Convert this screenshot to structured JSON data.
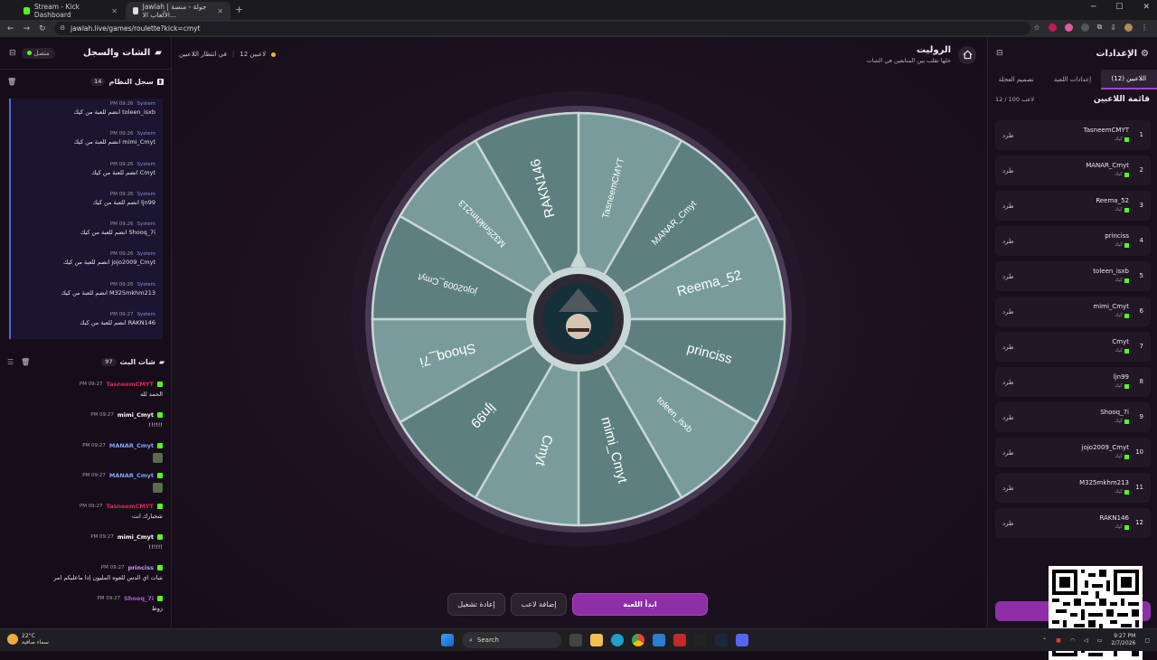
{
  "browser": {
    "tabs": [
      {
        "title": "Stream - Kick Dashboard",
        "color": "#53fc18"
      },
      {
        "title": "Jawlah | جولة - منصة الألعاب الا...",
        "color": "#ffffff"
      }
    ],
    "url": "jawlah.live/games/roulette?kick=cmyt"
  },
  "left_panel": {
    "title": "الشات والسجل",
    "status": "متصل",
    "system_log": {
      "title": "سجل النظام",
      "count": "14",
      "messages": [
        {
          "sender": "System",
          "time": "09:26 PM",
          "text": "toleen_isxb انضم للعبة من كيك"
        },
        {
          "sender": "System",
          "time": "09:26 PM",
          "text": "mimi_Cmyt انضم للعبة من كيك"
        },
        {
          "sender": "System",
          "time": "09:26 PM",
          "text": "Cmyt انضم للعبة من كيك"
        },
        {
          "sender": "System",
          "time": "09:26 PM",
          "text": "ljn99 انضم للعبة من كيك"
        },
        {
          "sender": "System",
          "time": "09:26 PM",
          "text": "Shooq_7i انضم للعبة من كيك"
        },
        {
          "sender": "System",
          "time": "09:26 PM",
          "text": "jojo2009_Cmyt انضم للعبة من كيك"
        },
        {
          "sender": "System",
          "time": "09:26 PM",
          "text": "M325mkhm213 انضم للعبة من كيك"
        },
        {
          "sender": "System",
          "time": "09:27 PM",
          "text": "RAKN146 انضم للعبة من كيك"
        }
      ]
    },
    "stream_chat": {
      "title": "شات البث",
      "count": "97",
      "messages": [
        {
          "user": "TasneemCMYT",
          "color": "#e0245e",
          "time": "09:27 PM",
          "text": "الحمد لله"
        },
        {
          "user": "mimi_Cmyt",
          "color": "#ffffff",
          "time": "09:27 PM",
          "text": "!!!!!!"
        },
        {
          "user": "MANAR_Cmyt",
          "color": "#7fa6ff",
          "time": "09:27 PM",
          "text": ""
        },
        {
          "user": "MANAR_Cmyt",
          "color": "#7fa6ff",
          "time": "09:27 PM",
          "text": ""
        },
        {
          "user": "TasneemCMYT",
          "color": "#e0245e",
          "time": "09:27 PM",
          "text": "شخبارك انت"
        },
        {
          "user": "mimi_Cmyt",
          "color": "#ffffff",
          "time": "09:27 PM",
          "text": "!!!!!!"
        },
        {
          "user": "princiss",
          "color": "#c896ff",
          "time": "09:27 PM",
          "text": "شات اي الدس للعوه المليون إذا ماعليكم امر"
        },
        {
          "user": "Shooq_7i",
          "color": "#b05ad8",
          "time": "09:27 PM",
          "text": "زوط"
        }
      ]
    }
  },
  "center": {
    "waiting_count": "12 لاعبين",
    "waiting_label": "في انتظار اللاعبين",
    "title": "الروليت",
    "subtitle": "خلها تقلب بين المتابعين في الشات",
    "wheel_segments": [
      "TasneemCMYT",
      "MANAR_Cmyt",
      "Reema_52",
      "princiss",
      "toleen_isxb",
      "mimi_Cmyt",
      "Cmyt",
      "ljn99",
      "Shooq_7i",
      "jojo2009_Cmyt",
      "M325mkhm213",
      "RAKN146"
    ],
    "colors": {
      "segment_a": "#7a9b9b",
      "segment_b": "#5e7f80",
      "rim": "#4a3a55"
    },
    "buttons": {
      "start": "ابدأ اللعبة",
      "add_player": "إضافة لاعب",
      "restart": "إعادة تشغيل"
    }
  },
  "right_panel": {
    "title": "الإعدادات",
    "tabs": [
      "اللاعبين (12)",
      "إعدادات اللعبة",
      "تصميم العجلة"
    ],
    "list_title": "قائمة اللاعبين",
    "list_count": "12 / 100 لاعب",
    "kick_label": "كيك",
    "kick_btn": "طرد",
    "players": [
      {
        "num": "1",
        "name": "TasneemCMYT"
      },
      {
        "num": "2",
        "name": "MANAR_Cmyt"
      },
      {
        "num": "3",
        "name": "Reema_52"
      },
      {
        "num": "4",
        "name": "princiss"
      },
      {
        "num": "5",
        "name": "toleen_isxb"
      },
      {
        "num": "6",
        "name": "mimi_Cmyt"
      },
      {
        "num": "7",
        "name": "Cmyt"
      },
      {
        "num": "8",
        "name": "ljn99"
      },
      {
        "num": "9",
        "name": "Shooq_7i"
      },
      {
        "num": "10",
        "name": "jojo2009_Cmyt"
      },
      {
        "num": "11",
        "name": "M325mkhm213"
      },
      {
        "num": "12",
        "name": "RAKN146"
      }
    ]
  },
  "taskbar": {
    "weather_temp": "22°C",
    "weather_desc": "سماء صافية",
    "search": "Search",
    "time": "9:27 PM",
    "date": "2/7/2026"
  }
}
